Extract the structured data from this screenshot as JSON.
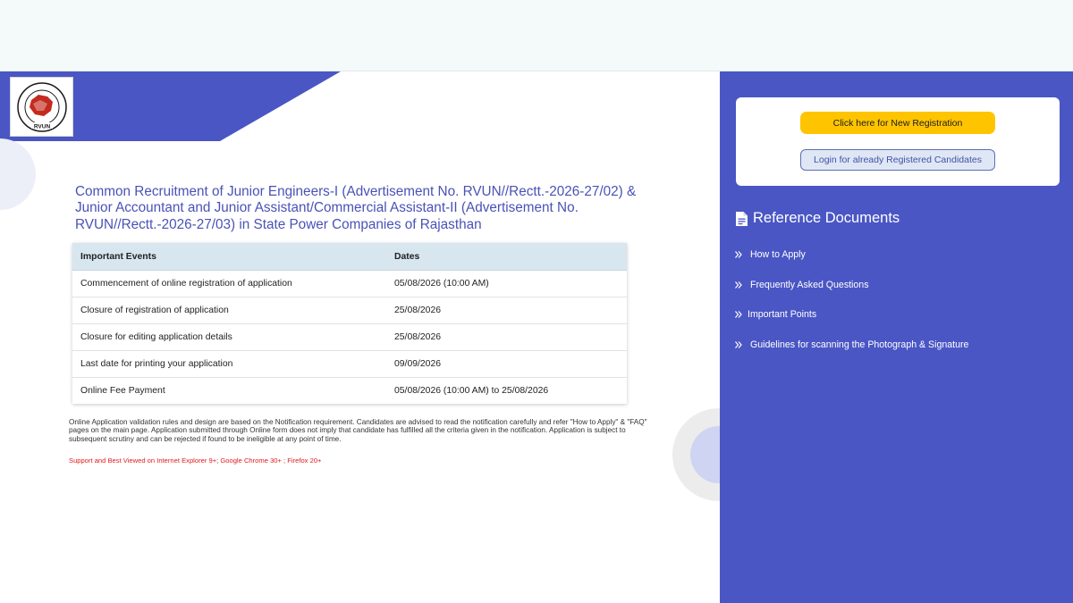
{
  "logo": {
    "alt": "RVUN"
  },
  "main": {
    "title": "Common Recruitment of Junior Engineers-I (Advertisement No. RVUN//Rectt.-2026-27/02) & Junior Accountant and Junior Assistant/Commercial Assistant-II (Advertisement No. RVUN//Rectt.-2026-27/03) in State Power Companies of Rajasthan",
    "table": {
      "headers": [
        "Important Events",
        "Dates"
      ],
      "rows": [
        [
          "Commencement of online registration of application",
          "05/08/2026 (10:00 AM)"
        ],
        [
          "Closure of registration of application",
          "25/08/2026"
        ],
        [
          "Closure for editing application details",
          "25/08/2026"
        ],
        [
          "Last date for printing your application",
          "09/09/2026"
        ],
        [
          "Online Fee Payment",
          "05/08/2026 (10:00 AM) to 25/08/2026"
        ]
      ]
    },
    "notice": "Online Application validation rules and design are based on the Notification requirement. Candidates are advised to read the notification carefully and refer \"How to Apply\" & \"FAQ\" pages on the main page. Application submitted through Online form does not imply that candidate has fulfilled all the criteria given in the notification. Application is subject to subsequent scrutiny and can be rejected if found to be ineligible at any point of time.",
    "support": "Support and Best Viewed on Internet Explorer 9+; Google Chrome 30+ ; Firefox 20+"
  },
  "sidebar": {
    "new_registration_label": "Click here for New Registration",
    "login_label": "Login for already Registered Candidates",
    "ref_heading": "Reference Documents",
    "ref_items": [
      {
        "label": "How to Apply",
        "icon": "double-chevron-right-icon"
      },
      {
        "label": "Frequently Asked Questions",
        "icon": "double-chevron-right-icon"
      },
      {
        "label": "Important Points",
        "icon": "double-chevron-right-icon"
      },
      {
        "label": "Guidelines for scanning the Photograph & Signature",
        "icon": "double-chevron-right-icon"
      }
    ]
  },
  "colors": {
    "accent": "#4a56c4",
    "title_text": "#4952b6",
    "primary_button": "#ffc400",
    "table_header": "#d8e6ef",
    "support_text": "#e01b1b"
  }
}
